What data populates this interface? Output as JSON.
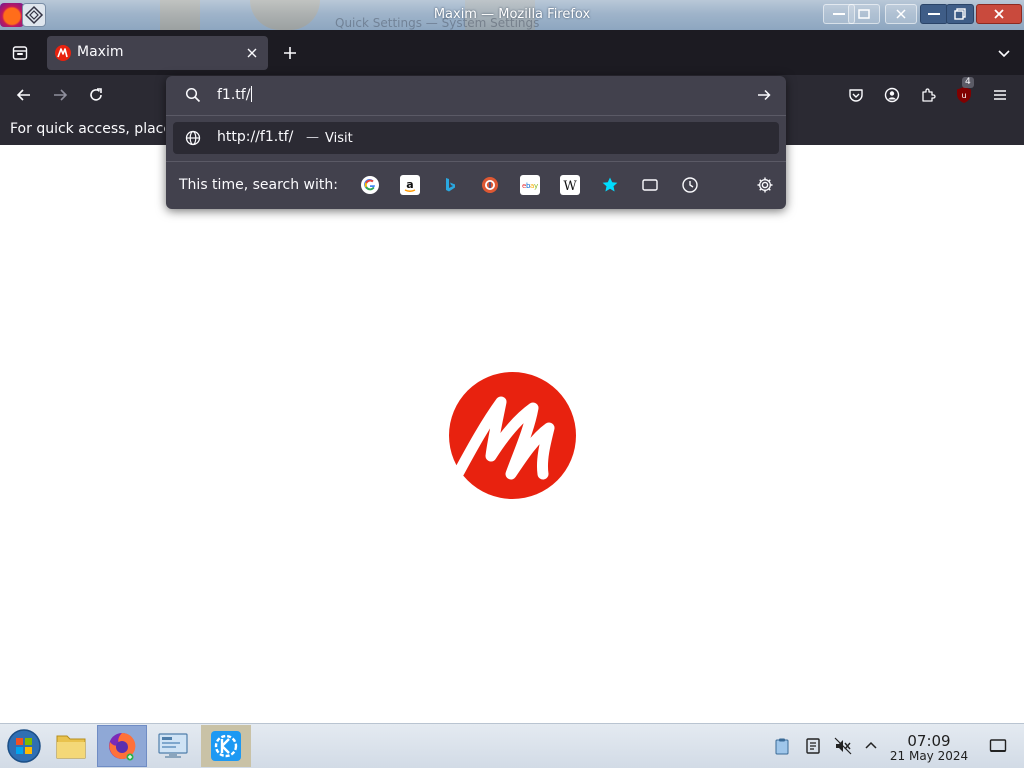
{
  "window": {
    "title": "Maxim — Mozilla Firefox",
    "ghost_text": "Quick Settings — System Settings"
  },
  "tabs": [
    {
      "label": "Maxim",
      "active": true
    }
  ],
  "urlbar": {
    "value": "f1.tf/",
    "suggestion_url": "http://f1.tf/",
    "suggestion_dash": "—",
    "suggestion_action": "Visit",
    "search_with_label": "This time, search with:",
    "engines": [
      "google-icon",
      "amazon-icon",
      "bing-icon",
      "duckduckgo-icon",
      "ebay-icon",
      "wikipedia-icon",
      "bookmarks-icon",
      "tabs-icon",
      "history-icon"
    ]
  },
  "toolbar": {
    "extension_badge": "4"
  },
  "bookmarks_bar": {
    "hint": "For quick access, place your bookmarks here on the bookmarks toolbar."
  },
  "page": {
    "logo_letter": "M",
    "logo_color": "#e8220f"
  },
  "taskbar": {
    "time": "07:09",
    "date": "21 May 2024"
  },
  "colors": {
    "toolbar_bg": "#2b2a33",
    "tabstrip_bg": "#1c1b22",
    "panel_bg": "#42414d",
    "text": "#fbfbfe"
  }
}
